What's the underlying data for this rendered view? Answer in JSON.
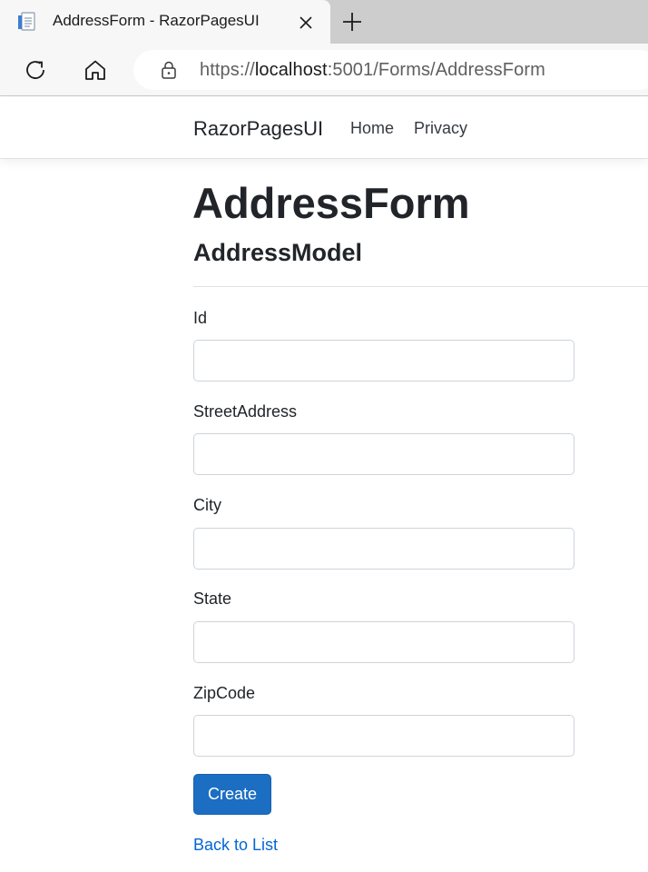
{
  "browser": {
    "tab_title": "AddressForm - RazorPagesUI",
    "url_scheme": "https://",
    "url_host": "localhost",
    "url_rest": ":5001/Forms/AddressForm",
    "icons": {
      "favicon": "page-icon",
      "tab_close": "close-icon",
      "new_tab": "plus-icon",
      "refresh": "refresh-icon",
      "home": "home-icon",
      "lock": "lock-icon"
    }
  },
  "navbar": {
    "brand": "RazorPagesUI",
    "links": [
      "Home",
      "Privacy"
    ]
  },
  "main": {
    "title": "AddressForm",
    "subtitle": "AddressModel",
    "fields": [
      {
        "label": "Id",
        "value": ""
      },
      {
        "label": "StreetAddress",
        "value": ""
      },
      {
        "label": "City",
        "value": ""
      },
      {
        "label": "State",
        "value": ""
      },
      {
        "label": "ZipCode",
        "value": ""
      }
    ],
    "submit_label": "Create",
    "back_link": "Back to List"
  },
  "colors": {
    "primary_button": "#1b6ec2",
    "link": "#0366d6"
  }
}
